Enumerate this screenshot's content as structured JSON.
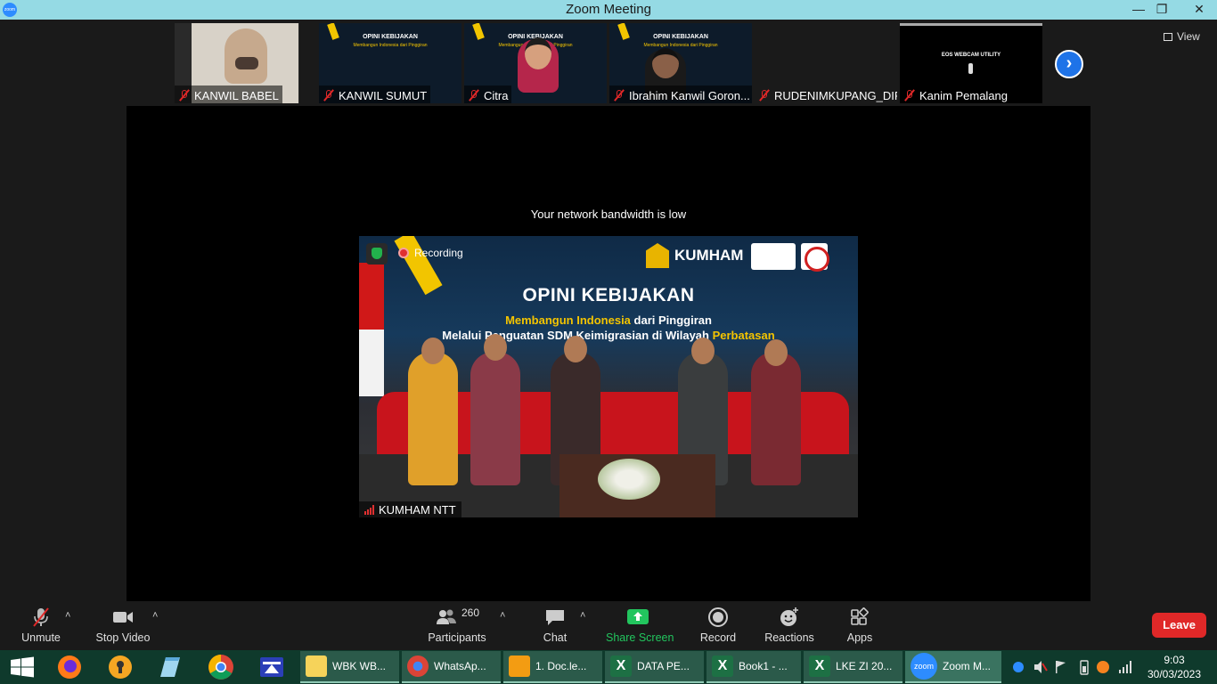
{
  "window": {
    "title": "Zoom Meeting",
    "app_icon_text": "zoom",
    "minimize_glyph": "—",
    "restore_glyph": "❐",
    "close_glyph": "✕"
  },
  "gallery": {
    "participants": [
      {
        "name": "KANWIL BABEL",
        "muted": true
      },
      {
        "name": "KANWIL SUMUT",
        "muted": true
      },
      {
        "name": "Citra",
        "muted": true
      },
      {
        "name": "Ibrahim Kanwil Goron...",
        "muted": true
      },
      {
        "name": "RUDENIMKUPANG_DIFI",
        "muted": true
      },
      {
        "name": "Kanim Pemalang",
        "muted": true
      }
    ],
    "slide_title": "OPINI KEBIJAKAN",
    "slide_line1": "Membangun Indonesia dari Pinggiran",
    "slide_line2": "Melalui Penguatan SDM Keimigrasian di Wilayah Perbatasan",
    "eos_text": "EOS WEBCAM UTILITY",
    "next_glyph": "›",
    "view_label": "View"
  },
  "stage": {
    "bandwidth_notice": "Your network bandwidth is low",
    "recording_label": "Recording",
    "logo_text": "KUMHAM",
    "headline": "OPINI KEBIJAKAN",
    "line1_a": "Membangun Indonesia",
    "line1_b": " dari Pinggiran",
    "line2_a": "Melalui Penguatan SDM Keimigrasian di Wilayah ",
    "line2_b": "Perbatasan",
    "speaker_name": "KUMHAM NTT"
  },
  "controls": {
    "unmute": "Unmute",
    "stop_video": "Stop Video",
    "participants_count": "260",
    "participants": "Participants",
    "chat": "Chat",
    "share_screen": "Share Screen",
    "record": "Record",
    "reactions": "Reactions",
    "apps": "Apps",
    "leave": "Leave",
    "caret": "˄"
  },
  "taskbar": {
    "items": [
      {
        "label": "WBK WB..."
      },
      {
        "label": "WhatsAp..."
      },
      {
        "label": "1. Doc.le..."
      },
      {
        "label": "DATA PE..."
      },
      {
        "label": "Book1 - ..."
      },
      {
        "label": "LKE ZI 20..."
      },
      {
        "label": "Zoom M..."
      }
    ],
    "excel_letter": "X",
    "zoom_logo_text": "zoom",
    "time": "9:03",
    "date": "30/03/2023"
  },
  "colors": {
    "titlebar": "#95dae4",
    "accent_blue": "#2d8cff",
    "leave_red": "#e02828",
    "share_green": "#22c55e",
    "taskbar": "#0f3a2c"
  }
}
